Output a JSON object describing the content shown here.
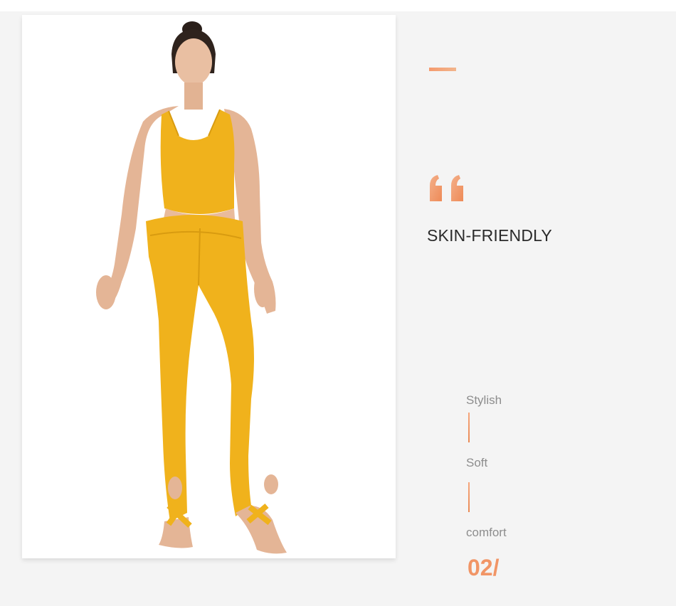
{
  "section": {
    "headline": "SKIN-FRIENDLY",
    "page_number": "02/",
    "features": [
      "Stylish",
      "Soft",
      "comfort"
    ]
  },
  "icons": {
    "quote": "quote-mark-icon",
    "dash": "accent-dash"
  },
  "colors": {
    "accent": "#f19566",
    "headline": "#2b2b2b",
    "feature_text": "#8d8d8d",
    "background": "#f4f4f4",
    "garment": "#f0b21c"
  },
  "image": {
    "alt": "Model wearing mustard-yellow sports bra top and stirrup leggings"
  }
}
